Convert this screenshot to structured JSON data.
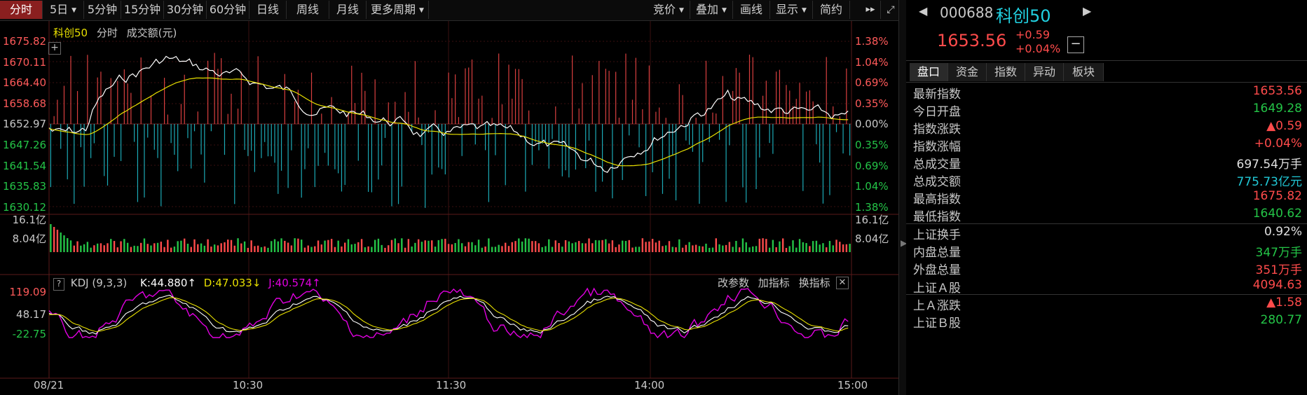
{
  "toolbar": {
    "periods": [
      {
        "label": "分时",
        "active": true
      },
      {
        "label": "5日",
        "dropdown": true
      },
      {
        "label": "5分钟"
      },
      {
        "label": "15分钟"
      },
      {
        "label": "30分钟"
      },
      {
        "label": "60分钟"
      },
      {
        "label": "日线"
      },
      {
        "label": "周线"
      },
      {
        "label": "月线"
      },
      {
        "label": "更多周期",
        "dropdown": true
      }
    ],
    "tools": [
      {
        "label": "竞价",
        "dropdown": true
      },
      {
        "label": "叠加",
        "dropdown": true
      },
      {
        "label": "画线"
      },
      {
        "label": "显示",
        "dropdown": true
      },
      {
        "label": "简约"
      }
    ],
    "forward_icon": "fast-forward-icon",
    "fullscreen_icon": "fullscreen-icon"
  },
  "chart_header": {
    "name": "科创50",
    "mode": "分时",
    "volume_unit": "成交额(元)"
  },
  "price_axis": {
    "left": [
      "1675.82",
      "1670.11",
      "1664.40",
      "1658.68",
      "1652.97",
      "1647.26",
      "1641.54",
      "1635.83",
      "1630.12"
    ],
    "right": [
      "1.38%",
      "1.04%",
      "0.69%",
      "0.35%",
      "0.00%",
      "0.35%",
      "0.69%",
      "1.04%",
      "1.38%"
    ]
  },
  "volume_axis": {
    "left": [
      "16.1亿",
      "8.04亿"
    ],
    "right": [
      "16.1亿",
      "8.04亿"
    ]
  },
  "kdj": {
    "help": "?",
    "name": "KDJ (9,3,3)",
    "k": "K:44.880↑",
    "d": "D:47.033↓",
    "j": "J:40.574↑",
    "buttons": [
      "改参数",
      "加指标",
      "换指标"
    ],
    "axis": [
      "119.09",
      "48.17",
      "-22.75"
    ]
  },
  "time_axis": [
    "08/21",
    "10:30",
    "11:30",
    "14:00",
    "15:00"
  ],
  "colors": {
    "up": "#ff4b4b",
    "down": "#21c8d6",
    "price": "#ffffff",
    "avg": "#e8e000",
    "k": "#ffffff",
    "d": "#e8e000",
    "j": "#e000e0",
    "green": "#24c447",
    "yellow": "#e8e000",
    "axis_red": "#ff5a5a",
    "axis_green": "#24c447"
  },
  "panel": {
    "code": "000688",
    "name": "科创50",
    "price": "1653.56",
    "change": "+0.59",
    "change_pct": "+0.04%",
    "minus": "−",
    "tabs": [
      "盘口",
      "资金",
      "指数",
      "异动",
      "板块"
    ],
    "rows": [
      {
        "label": "最新指数",
        "value": "1653.56",
        "color": "#ff4b4b"
      },
      {
        "label": "今日开盘",
        "value": "1649.28",
        "color": "#24c447"
      },
      {
        "label": "指数涨跌",
        "value": "▲0.59",
        "color": "#ff4b4b"
      },
      {
        "label": "指数涨幅",
        "value": "+0.04%",
        "color": "#ff4b4b"
      },
      {
        "label": "总成交量",
        "value": "697.54",
        "unit": "万手",
        "color": "#e0e0e0"
      },
      {
        "label": "总成交额",
        "value": "775.73",
        "unit": "亿元",
        "color": "#21c8d6"
      },
      {
        "label": "最高指数",
        "value": "1675.82",
        "color": "#ff4b4b"
      },
      {
        "label": "最低指数",
        "value": "1640.62",
        "color": "#24c447"
      },
      {
        "label": "上证换手",
        "value": "0.92%",
        "color": "#e0e0e0"
      },
      {
        "label": "内盘总量",
        "value": "347",
        "unit": "万手",
        "color": "#24c447"
      },
      {
        "label": "外盘总量",
        "value": "351",
        "unit": "万手",
        "color": "#ff4b4b"
      },
      {
        "label": "上证Ａ股",
        "value": "4094.63",
        "color": "#ff4b4b"
      },
      {
        "label": "上Ａ涨跌",
        "value": "▲1.58",
        "color": "#ff4b4b"
      },
      {
        "label": "上证Ｂ股",
        "value": "280.77",
        "color": "#24c447"
      }
    ]
  }
}
